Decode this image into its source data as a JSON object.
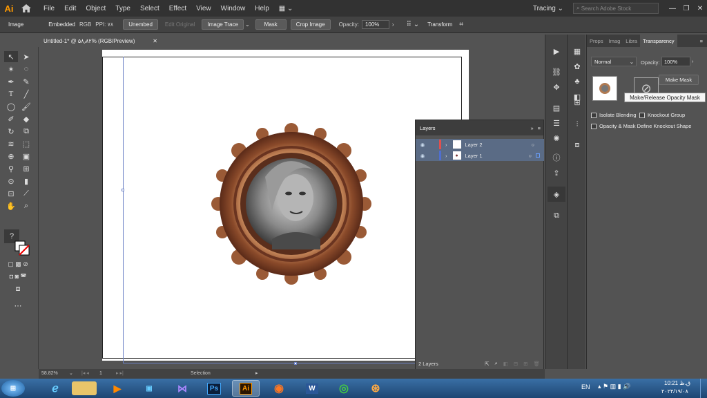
{
  "app": {
    "logo": "Ai"
  },
  "menu": [
    "File",
    "Edit",
    "Object",
    "Type",
    "Select",
    "Effect",
    "View",
    "Window",
    "Help"
  ],
  "workspace": {
    "label": "Tracing",
    "search_placeholder": "Search Adobe Stock"
  },
  "control": {
    "type_label": "Image",
    "embedded": "Embedded",
    "rgb": "RGB",
    "ppi": "PPI: ۷۸",
    "unembed": "Unembed",
    "edit_original": "Edit Original",
    "image_trace": "Image Trace",
    "mask": "Mask",
    "crop_image": "Crop Image",
    "opacity_label": "Opacity:",
    "opacity_value": "100%",
    "transform": "Transform"
  },
  "document": {
    "tab_title": "Untitled-1* @ ۵۸٫۸۲% (RGB/Preview)"
  },
  "transparency": {
    "tabs": [
      "Props",
      "Imag",
      "Libra",
      "Transparency"
    ],
    "blend_mode": "Normal",
    "opacity_label": "Opacity:",
    "opacity_value": "100%",
    "make_mask": "Make Mask",
    "tooltip": "Make/Release Opacity Mask",
    "isolate": "Isolate Blending",
    "knockout": "Knockout Group",
    "opacity_mask": "Opacity & Mask Define Knockout Shape"
  },
  "layers": {
    "title": "Layers",
    "items": [
      {
        "name": "Layer 2",
        "color": "#e0504e"
      },
      {
        "name": "Layer 1",
        "color": "#4f6fd0"
      }
    ],
    "count": "2 Layers"
  },
  "status": {
    "zoom": "58.82%",
    "artboard": "1",
    "tool": "Selection"
  },
  "taskbar": {
    "lang": "EN",
    "time": "ق.ظ 10:21",
    "date": "۲۰۲۴/۱۹/۰۸"
  }
}
